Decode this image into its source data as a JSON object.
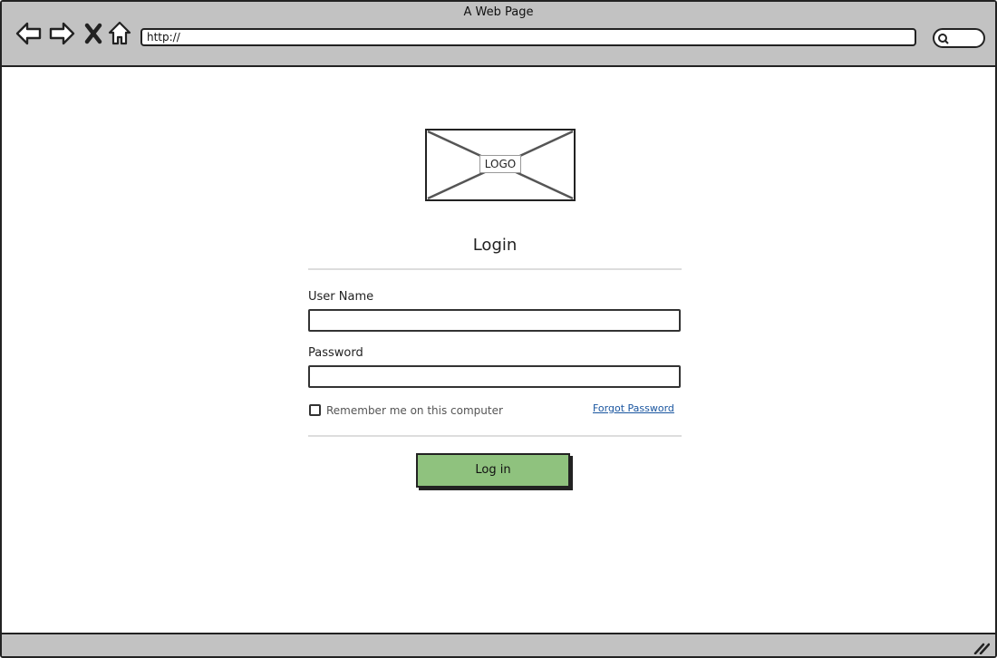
{
  "window": {
    "title": "A Web Page"
  },
  "browser": {
    "nav_icons": [
      "back-arrow-icon",
      "forward-arrow-icon",
      "close-x-icon",
      "home-icon"
    ],
    "url": "http://",
    "search_icon": "search-icon"
  },
  "logo": {
    "label": "LOGO"
  },
  "form": {
    "title": "Login",
    "username_label": "User Name",
    "username_value": "",
    "password_label": "Password",
    "password_value": "",
    "remember_label": "Remember me on this computer",
    "remember_checked": false,
    "forgot_label": "Forgot Password",
    "submit_label": "Log in"
  },
  "colors": {
    "chrome": "#c2c2c2",
    "button": "#8fc27e",
    "link": "#1a56a0"
  }
}
